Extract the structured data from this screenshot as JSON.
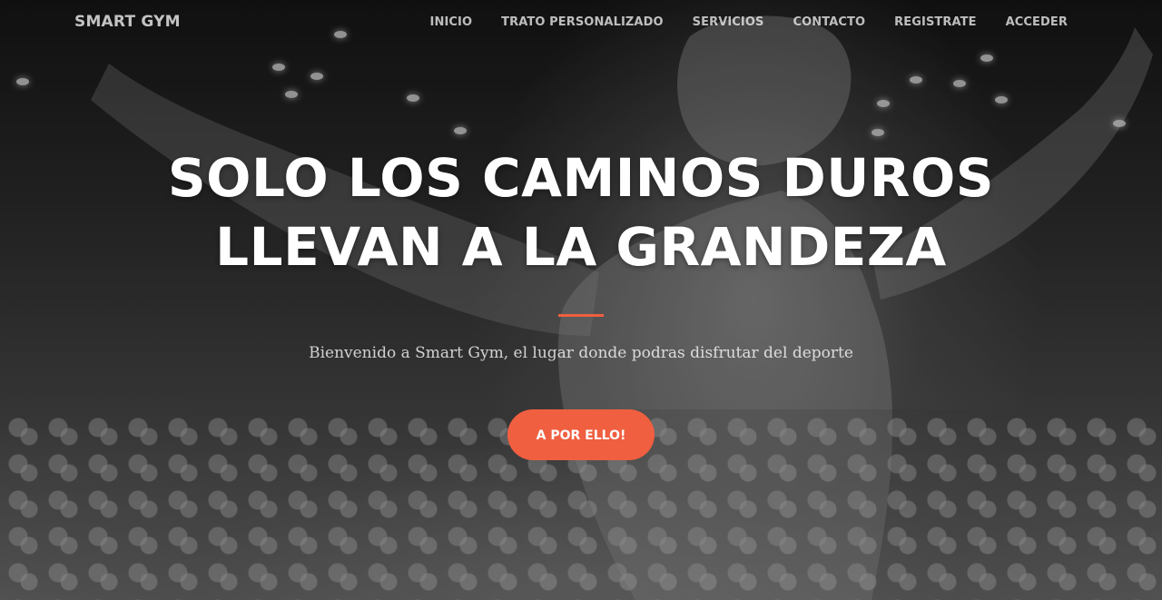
{
  "navbar": {
    "brand": "SMART GYM",
    "items": [
      {
        "label": "INICIO"
      },
      {
        "label": "TRATO PERSONALIZADO"
      },
      {
        "label": "SERVICIOS"
      },
      {
        "label": "CONTACTO"
      },
      {
        "label": "REGISTRATE"
      },
      {
        "label": "ACCEDER"
      }
    ]
  },
  "hero": {
    "heading_line1": "SOLO LOS CAMINOS DUROS",
    "heading_line2": "LLEVAN A LA GRANDEZA",
    "subtitle": "Bienvenido a Smart Gym, el lugar donde podras disfrutar del deporte",
    "cta_label": "A POR ELLO!"
  },
  "colors": {
    "accent": "#f05f40",
    "text": "#ffffff"
  }
}
